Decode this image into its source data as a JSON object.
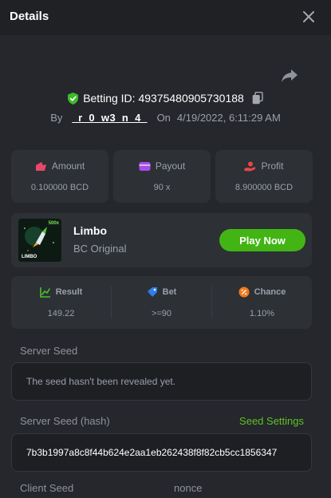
{
  "header": {
    "title": "Details"
  },
  "bet": {
    "betting_id_label": "Betting ID: 49375480905730188",
    "by_label": "By",
    "username": "_r_0_w3_n_4_",
    "on_label": "On",
    "datetime": "4/19/2022, 6:11:29 AM"
  },
  "stats": [
    {
      "label": "Amount",
      "value": "0.100000 BCD",
      "icon": "amount-icon"
    },
    {
      "label": "Payout",
      "value": "90 x",
      "icon": "payout-icon"
    },
    {
      "label": "Profit",
      "value": "8.900000 BCD",
      "icon": "profit-icon"
    }
  ],
  "game": {
    "name": "Limbo",
    "provider": "BC Original",
    "thumb_text": "LIMBO",
    "thumb_badge": "500x",
    "play_label": "Play Now"
  },
  "results": [
    {
      "label": "Result",
      "value": "149.22",
      "icon": "result-chart-icon"
    },
    {
      "label": "Bet",
      "value": ">=90",
      "icon": "bet-tag-icon"
    },
    {
      "label": "Chance",
      "value": "1.10%",
      "icon": "chance-percent-icon"
    }
  ],
  "seeds": {
    "server_seed_label": "Server Seed",
    "server_seed_value": "The seed hasn't been revealed yet.",
    "server_hash_label": "Server Seed (hash)",
    "seed_settings_label": "Seed Settings",
    "server_hash_value": "7b3b1997a8c8f44b624e2aa1eb262438f8f82cb5cc1856347",
    "client_seed_label": "Client Seed",
    "nonce_label": "nonce"
  },
  "colors": {
    "accent_green": "#42b515",
    "link_green": "#5fc221",
    "background": "#25272c",
    "card": "#2d3035"
  }
}
